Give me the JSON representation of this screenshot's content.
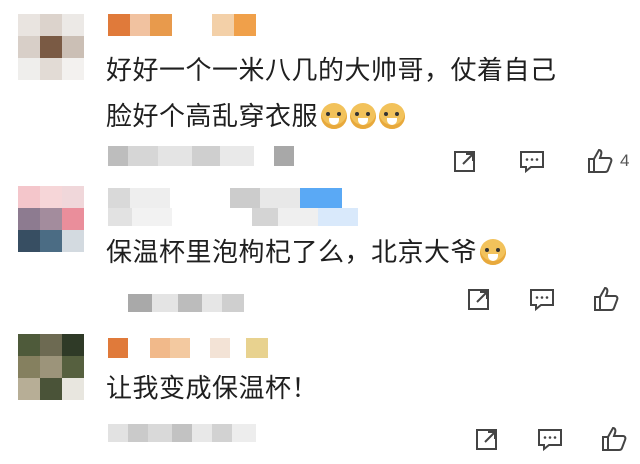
{
  "comments": [
    {
      "text": "好好一个一米八几的大帅哥，仗着自己",
      "text2": "脸好个高乱穿衣服",
      "emoji_count": 3,
      "emoji_icon": "doge-emoji-icon",
      "like_count": "4",
      "colors": {
        "name": [
          "#e07a3a",
          "#f1c2a0",
          "#e89a4c",
          "#ffffff",
          "#f3d0a8",
          "#f0a04a"
        ]
      }
    },
    {
      "text": "保温杯里泡枸杞了么，北京大爷",
      "emoji_count": 1,
      "emoji_icon": "doge-emoji-icon",
      "like_count": "",
      "colors": {
        "name": [
          "#d9d9d9",
          "#eeeeee",
          "#ffffff",
          "#cccccc",
          "#e8e8e8",
          "#5aa9f5"
        ]
      }
    },
    {
      "text": "让我变成保温杯！",
      "emoji_count": 0,
      "like_count": "",
      "colors": {
        "name": [
          "#e07a3a",
          "#ffffff",
          "#f1b98a",
          "#f3c9a0",
          "#ffffff",
          "#e8d28f"
        ]
      }
    }
  ],
  "icons": {
    "forward": "forward-icon",
    "reply": "comment-icon",
    "like": "thumbs-up-icon"
  }
}
